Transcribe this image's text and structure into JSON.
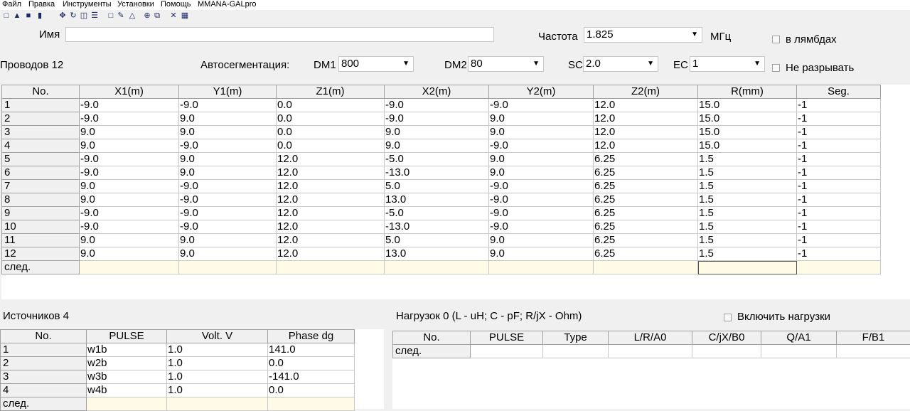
{
  "menu": [
    "Файл",
    "Правка",
    "Инструменты",
    "Установки",
    "Помощь",
    "MMANA-GALpro"
  ],
  "toolbar": [
    "new-icon",
    "open-icon",
    "save-icon",
    "info-icon",
    "move-icon",
    "rotate-icon",
    "copy-icon",
    "list-icon",
    "page-icon",
    "edit-icon",
    "triangle-icon",
    "target-icon",
    "copy2-icon",
    "tools-icon",
    "calculator-icon"
  ],
  "top": {
    "name_label": "Имя",
    "name_value": "",
    "freq_label": "Частота",
    "freq_value": "1.825",
    "freq_unit": "МГц",
    "lambda_label": "в лямбдах",
    "wires_label": "Проводов 12",
    "autoseg_label": "Автосегментация:",
    "dm1_label": "DM1",
    "dm1_value": "800",
    "dm2_label": "DM2",
    "dm2_value": "80",
    "sc_label": "SC",
    "sc_value": "2.0",
    "ec_label": "EC",
    "ec_value": "1",
    "nobreak_label": "Не разрывать"
  },
  "wires": {
    "headers": [
      "No.",
      "X1(m)",
      "Y1(m)",
      "Z1(m)",
      "X2(m)",
      "Y2(m)",
      "Z2(m)",
      "R(mm)",
      "Seg."
    ],
    "rows": [
      [
        "1",
        "-9.0",
        "-9.0",
        "0.0",
        "-9.0",
        "-9.0",
        "12.0",
        "15.0",
        "-1"
      ],
      [
        "2",
        "-9.0",
        "9.0",
        "0.0",
        "-9.0",
        "9.0",
        "12.0",
        "15.0",
        "-1"
      ],
      [
        "3",
        "9.0",
        "9.0",
        "0.0",
        "9.0",
        "9.0",
        "12.0",
        "15.0",
        "-1"
      ],
      [
        "4",
        "9.0",
        "-9.0",
        "0.0",
        "9.0",
        "-9.0",
        "12.0",
        "15.0",
        "-1"
      ],
      [
        "5",
        "-9.0",
        "9.0",
        "12.0",
        "-5.0",
        "9.0",
        "6.25",
        "1.5",
        "-1"
      ],
      [
        "6",
        "-9.0",
        "9.0",
        "12.0",
        "-13.0",
        "9.0",
        "6.25",
        "1.5",
        "-1"
      ],
      [
        "7",
        "9.0",
        "-9.0",
        "12.0",
        "5.0",
        "-9.0",
        "6.25",
        "1.5",
        "-1"
      ],
      [
        "8",
        "9.0",
        "-9.0",
        "12.0",
        "13.0",
        "-9.0",
        "6.25",
        "1.5",
        "-1"
      ],
      [
        "9",
        "-9.0",
        "-9.0",
        "12.0",
        "-5.0",
        "-9.0",
        "6.25",
        "1.5",
        "-1"
      ],
      [
        "10",
        "-9.0",
        "-9.0",
        "12.0",
        "-13.0",
        "-9.0",
        "6.25",
        "1.5",
        "-1"
      ],
      [
        "11",
        "9.0",
        "9.0",
        "12.0",
        "5.0",
        "9.0",
        "6.25",
        "1.5",
        "-1"
      ],
      [
        "12",
        "9.0",
        "9.0",
        "12.0",
        "13.0",
        "9.0",
        "6.25",
        "1.5",
        "-1"
      ]
    ],
    "next_label": "след."
  },
  "sources": {
    "title": "Источников 4",
    "headers": [
      "No.",
      "PULSE",
      "Volt. V",
      "Phase dg"
    ],
    "rows": [
      [
        "1",
        "w1b",
        "1.0",
        "141.0"
      ],
      [
        "2",
        "w2b",
        "1.0",
        "0.0"
      ],
      [
        "3",
        "w3b",
        "1.0",
        "-141.0"
      ],
      [
        "4",
        "w4b",
        "1.0",
        "0.0"
      ]
    ],
    "next_label": "след."
  },
  "loads": {
    "title": "Нагрузок 0 (L - uH; C - pF; R/jX - Ohm)",
    "enable_label": "Включить нагрузки",
    "headers": [
      "No.",
      "PULSE",
      "Type",
      "L/R/A0",
      "C/jX/B0",
      "Q/A1",
      "F/B1"
    ],
    "next_label": "след."
  }
}
